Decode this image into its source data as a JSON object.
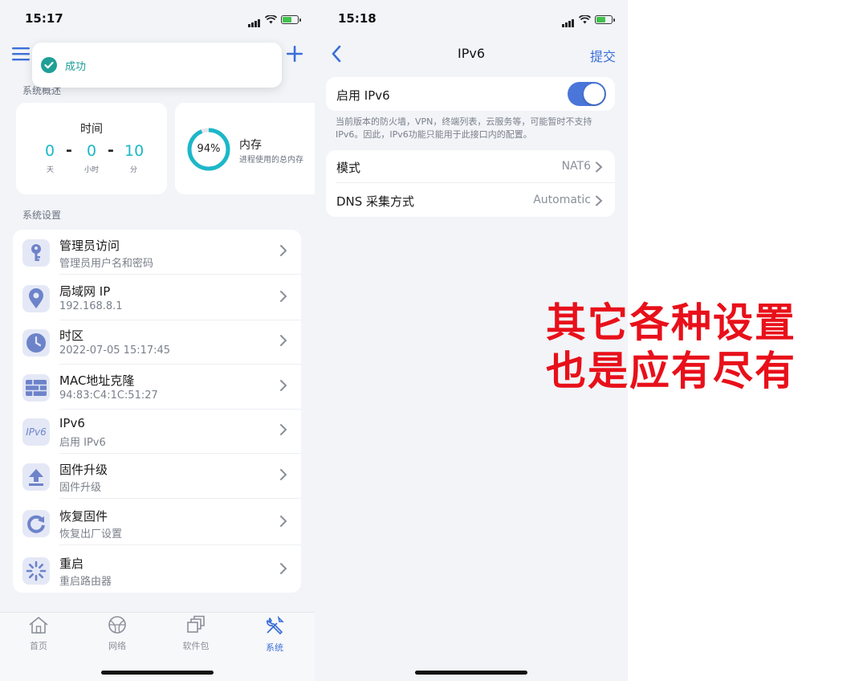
{
  "phone1": {
    "status_time": "15:17",
    "toast": {
      "text": "成功"
    },
    "overview_label": "系统概述",
    "time_card": {
      "title": "时间",
      "days": "0",
      "hours": "0",
      "minutes": "10",
      "days_unit": "天",
      "hours_unit": "小时",
      "minutes_unit": "分",
      "sep1": "-",
      "sep2": "-"
    },
    "memory_card": {
      "percent_text": "94%",
      "percent": 94,
      "title": "内存",
      "subtitle": "进程使用的总内存"
    },
    "settings_label": "系统设置",
    "items": [
      {
        "title": "管理员访问",
        "sub": "管理员用户名和密码",
        "icon": "key-icon"
      },
      {
        "title": "局域网 IP",
        "sub": "192.168.8.1",
        "icon": "location-pin-icon"
      },
      {
        "title": "时区",
        "sub": "2022-07-05 15:17:45",
        "icon": "clock-icon"
      },
      {
        "title": "MAC地址克隆",
        "sub": "94:83:C4:1C:51:27",
        "icon": "brick-wall-icon"
      },
      {
        "title": "IPv6",
        "sub": "启用 IPv6",
        "icon": "ipv6-icon",
        "icon_text": "IPv6"
      },
      {
        "title": "固件升级",
        "sub": "固件升级",
        "icon": "upload-icon"
      },
      {
        "title": "恢复固件",
        "sub": "恢复出厂设置",
        "icon": "restore-icon"
      },
      {
        "title": "重启",
        "sub": "重启路由器",
        "icon": "reboot-icon"
      }
    ],
    "tabs": [
      {
        "label": "首页",
        "icon": "home-icon",
        "active": false
      },
      {
        "label": "网络",
        "icon": "globe-icon",
        "active": false
      },
      {
        "label": "软件包",
        "icon": "packages-icon",
        "active": false
      },
      {
        "label": "系统",
        "icon": "tools-icon",
        "active": true
      }
    ]
  },
  "phone2": {
    "status_time": "15:18",
    "nav": {
      "title": "IPv6",
      "submit": "提交"
    },
    "toggle": {
      "label": "启用 IPv6",
      "on": true
    },
    "note": "当前版本的防火墙，VPN，终端列表，云服务等，可能暂时不支持IPv6。因此，IPv6功能只能用于此接口内的配置。",
    "rows": [
      {
        "label": "模式",
        "value": "NAT6"
      },
      {
        "label": "DNS 采集方式",
        "value": "Automatic"
      }
    ]
  },
  "caption": {
    "line1": "其它各种设置",
    "line2": "也是应有尽有"
  },
  "colors": {
    "accent": "#3b6fd8",
    "teal": "#1cb7c9",
    "icon_bg": "#e4e8f6",
    "icon_fg": "#6d83c9",
    "red": "#e8101a"
  }
}
